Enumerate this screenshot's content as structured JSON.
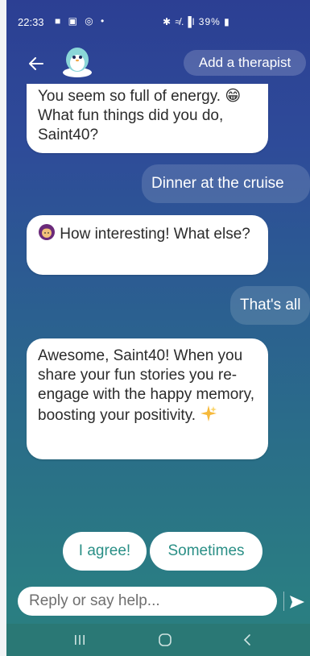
{
  "status_bar": {
    "time": "22:33",
    "left_icons": "■ ▣ ◎ •",
    "right": "✱ ≉.▐l 39% ▮"
  },
  "header": {
    "add_therapist_label": "Add a therapist"
  },
  "messages": [
    {
      "from": "bot",
      "text": "You seem so full of energy. 😁 What fun things did you do, Saint40?"
    },
    {
      "from": "user",
      "text": "Dinner at the cruise"
    },
    {
      "from": "bot",
      "text": "How interesting! What else?"
    },
    {
      "from": "user",
      "text": "That's all"
    },
    {
      "from": "bot",
      "text": "Awesome, Saint40! When you share your fun stories you re-engage with the happy memory, boosting your positivity."
    }
  ],
  "quick_replies": [
    "I agree!",
    "Sometimes"
  ],
  "composer": {
    "placeholder": "Reply or say help..."
  },
  "colors": {
    "gradient_top": "#2c3f93",
    "gradient_bottom": "#2b807f",
    "accent_teal": "#2a8f86",
    "nav_bar": "#2a7875"
  },
  "icons": {
    "back": "arrow-left-icon",
    "avatar": "wysa-penguin-avatar",
    "emoji_grin": "grinning-face-icon",
    "emoji_person": "person-emoji-icon",
    "emoji_sparkle": "sparkle-icon",
    "send": "send-icon",
    "nav_recent": "recent-apps-icon",
    "nav_home": "home-icon",
    "nav_back": "back-chevron-icon"
  }
}
